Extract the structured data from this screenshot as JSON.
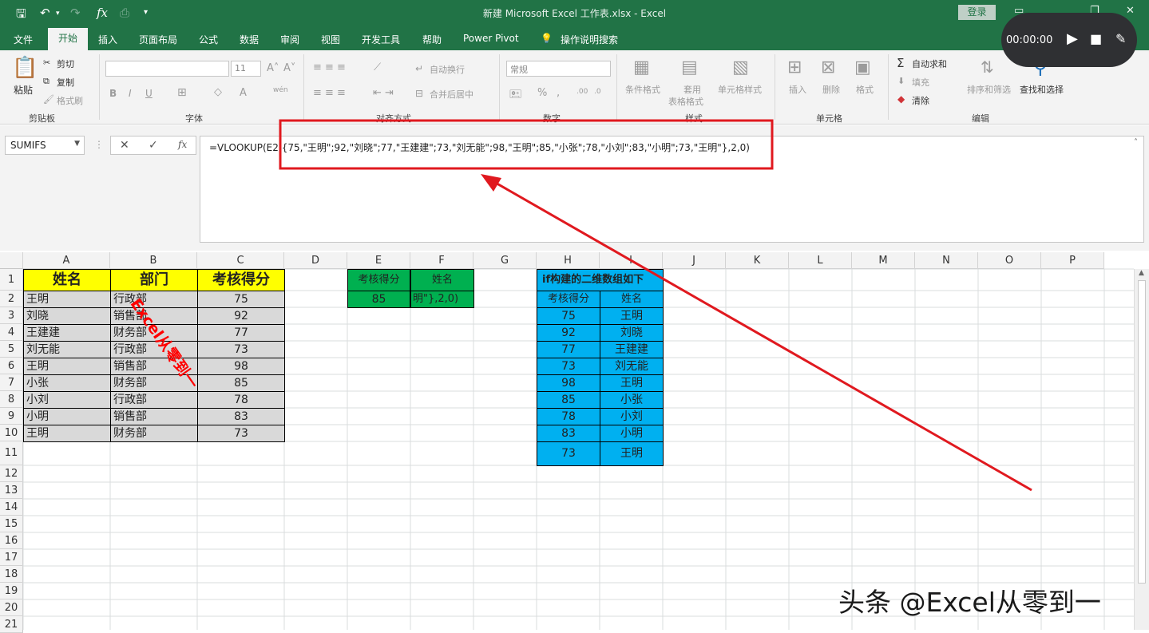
{
  "window": {
    "title": "新建 Microsoft Excel 工作表.xlsx  -  Excel",
    "login": "登录"
  },
  "tabs": [
    "文件",
    "开始",
    "插入",
    "页面布局",
    "公式",
    "数据",
    "审阅",
    "视图",
    "开发工具",
    "帮助",
    "Power Pivot",
    "操作说明搜索"
  ],
  "ribbon": {
    "clipboard": {
      "paste": "粘贴",
      "cut": "剪切",
      "copy": "复制",
      "format_painter": "格式刷",
      "label": "剪贴板"
    },
    "font": {
      "size": "11",
      "label": "字体",
      "wen": "wén"
    },
    "alignment": {
      "wrap": "自动换行",
      "merge": "合并后居中",
      "label": "对齐方式"
    },
    "number": {
      "format": "常规",
      "label": "数字"
    },
    "styles": {
      "conditional": "条件格式",
      "table_l1": "套用",
      "table_l2": "表格格式",
      "cell_styles": "单元格样式",
      "label": "样式"
    },
    "cells": {
      "insert": "插入",
      "delete": "删除",
      "format": "格式",
      "label": "单元格"
    },
    "editing": {
      "autosum": "自动求和",
      "fill": "填充",
      "clear": "清除",
      "sort": "排序和筛选",
      "find": "查找和选择",
      "label": "编辑"
    }
  },
  "recorder": {
    "time": "00:00:00"
  },
  "formula_bar": {
    "name_box": "SUMIFS",
    "formula": "=VLOOKUP(E2,{75,\"王明\";92,\"刘晓\";77,\"王建建\";73,\"刘无能\";98,\"王明\";85,\"小张\";78,\"小刘\";83,\"小明\";73,\"王明\"},2,0)"
  },
  "columns": [
    "A",
    "B",
    "C",
    "D",
    "E",
    "F",
    "G",
    "H",
    "I",
    "J",
    "K",
    "L",
    "M",
    "N",
    "O",
    "P"
  ],
  "rows": [
    "1",
    "2",
    "3",
    "4",
    "5",
    "6",
    "7",
    "8",
    "9",
    "10",
    "11",
    "12",
    "13",
    "14",
    "15",
    "16",
    "17",
    "18",
    "19",
    "20",
    "21"
  ],
  "table1": {
    "headers": [
      "姓名",
      "部门",
      "考核得分"
    ],
    "rows": [
      [
        "王明",
        "行政部",
        "75"
      ],
      [
        "刘晓",
        "销售部",
        "92"
      ],
      [
        "王建建",
        "财务部",
        "77"
      ],
      [
        "刘无能",
        "行政部",
        "73"
      ],
      [
        "王明",
        "销售部",
        "98"
      ],
      [
        "小张",
        "财务部",
        "85"
      ],
      [
        "小刘",
        "行政部",
        "78"
      ],
      [
        "小明",
        "销售部",
        "83"
      ],
      [
        "王明",
        "财务部",
        "73"
      ]
    ]
  },
  "lookup": {
    "h1": "考核得分",
    "h2": "姓名",
    "e2": "85",
    "f2": "明\"},2,0)"
  },
  "array_table": {
    "title": "if构建的二维数组如下",
    "h1": "考核得分",
    "h2": "姓名",
    "rows": [
      [
        "75",
        "王明"
      ],
      [
        "92",
        "刘晓"
      ],
      [
        "77",
        "王建建"
      ],
      [
        "73",
        "刘无能"
      ],
      [
        "98",
        "王明"
      ],
      [
        "85",
        "小张"
      ],
      [
        "78",
        "小刘"
      ],
      [
        "83",
        "小明"
      ],
      [
        "73",
        "王明"
      ]
    ]
  },
  "watermark": "Excel从零到一",
  "footer_watermark": "头条 @Excel从零到一",
  "colors": {
    "excel_green": "#217346",
    "header_yellow": "#ffff00",
    "gray": "#d9d9d9",
    "green": "#00b050",
    "blue": "#00b0f0",
    "annotation_red": "#e0191f"
  }
}
